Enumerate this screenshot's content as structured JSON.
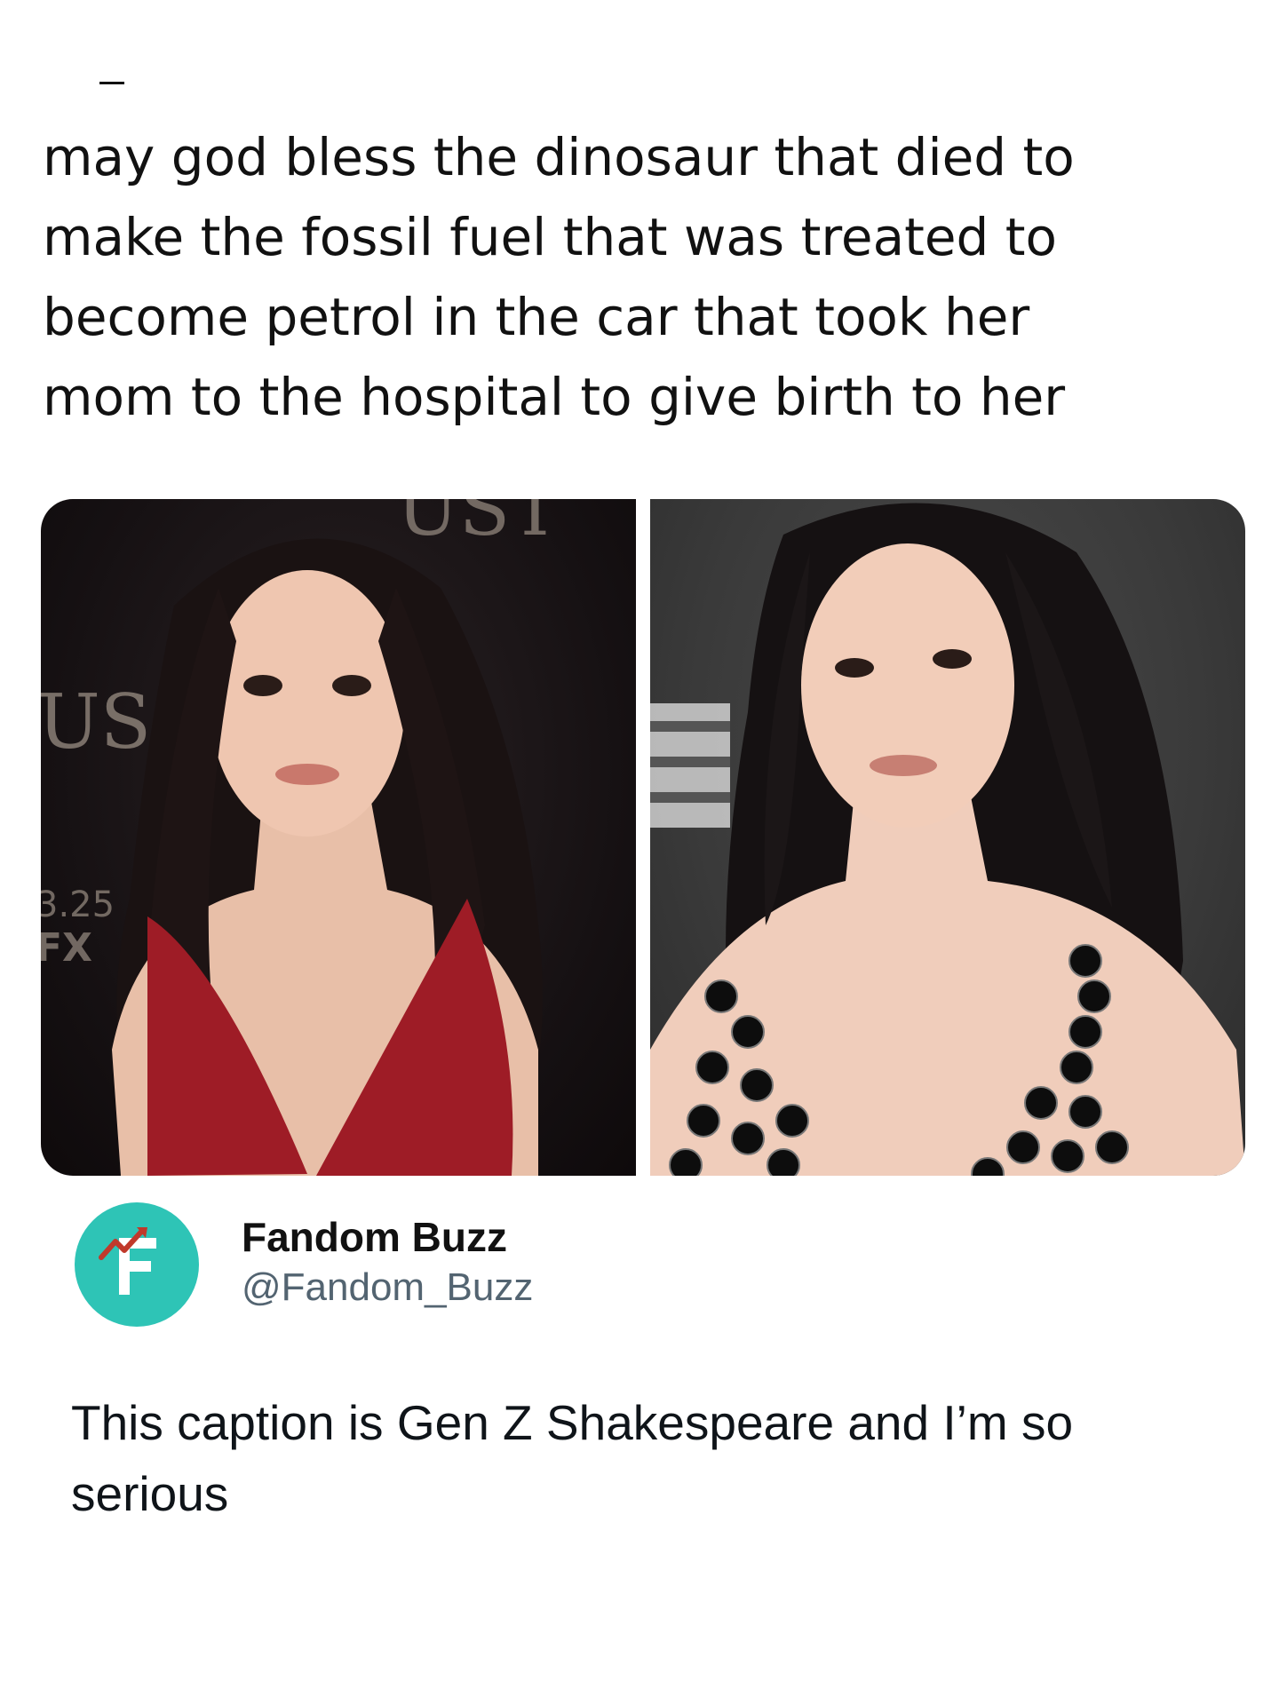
{
  "quoted_post": {
    "text": "may god bless the dinosaur that died to\nmake the fossil fuel that was treated to\nbecome petrol in the car that took her\nmom to the hospital to give birth to her"
  },
  "media": {
    "left_photo": {
      "backdrop_text_top": "UST",
      "backdrop_text_side": "US",
      "backdrop_date": "3.25",
      "backdrop_logo": "FX"
    },
    "right_photo": {}
  },
  "author": {
    "display_name": "Fandom Buzz",
    "handle": "@Fandom_Buzz",
    "avatar_letter": "F",
    "avatar_color": "#2ec4b6"
  },
  "post": {
    "text": "This caption is Gen Z Shakespeare and I’m so serious"
  }
}
